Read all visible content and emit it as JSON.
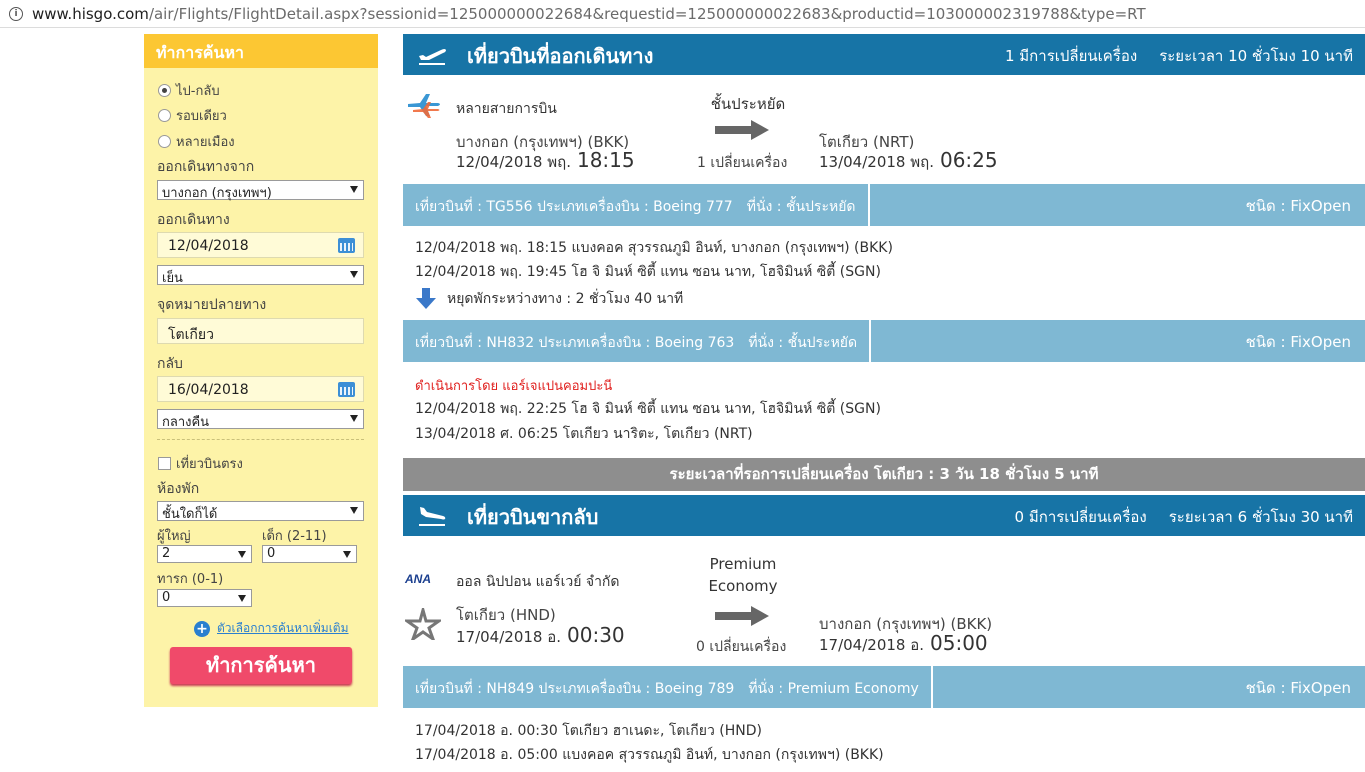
{
  "browser": {
    "url_host": "www.hisgo.com",
    "url_path": "/air/Flights/FlightDetail.aspx?sessionid=125000000022684&requestid=125000000022683&productid=103000002319788&type=RT"
  },
  "sidebar": {
    "title": "ทำการค้นหา",
    "trip_types": [
      {
        "label": "ไป-กลับ",
        "selected": true
      },
      {
        "label": "รอบเดียว",
        "selected": false
      },
      {
        "label": "หลายเมือง",
        "selected": false
      }
    ],
    "origin_label": "ออกเดินทางจาก",
    "origin_value": "บางกอก (กรุงเทพฯ)",
    "depart_label": "ออกเดินทาง",
    "depart_date": "12/04/2018",
    "depart_time": "เย็น",
    "destination_label": "จุดหมายปลายทาง",
    "destination_value": "โตเกียว",
    "return_label": "กลับ",
    "return_date": "16/04/2018",
    "return_time": "กลางคืน",
    "direct_label": "เที่ยวบินตรง",
    "cabin_label": "ห้องพัก",
    "cabin_value": "ชั้นใดก็ได้",
    "adult_label": "ผู้ใหญ่",
    "adult_value": "2",
    "child_label": "เด็ก (2-11)",
    "child_value": "0",
    "infant_label": "ทารก (0-1)",
    "infant_value": "0",
    "more_options": "ตัวเลือกการค้นหาเพิ่มเติม",
    "search_button": "ทำการค้นหา"
  },
  "outbound": {
    "title": "เที่ยวบินที่ออกเดินทาง",
    "stops_summary": "1 มีการเปลี่ยนเครื่อง",
    "duration_summary": "ระยะเวลา 10 ชั่วโมง 10 นาที",
    "airline": "หลายสายการบิน",
    "cabin": "ชั้นประหยัด",
    "stops": "1 เปลี่ยนเครื่อง",
    "from_city": "บางกอก (กรุงเทพฯ) (BKK)",
    "from_date": "12/04/2018 พฤ.",
    "from_time": "18:15",
    "to_city": "โตเกียว (NRT)",
    "to_date": "13/04/2018 พฤ.",
    "to_time": "06:25",
    "segments": [
      {
        "flight": "เที่ยวบินที่ : TG556 ประเภทเครื่องบิน : Boeing 777",
        "seat": "ที่นั่ง : ชั้นประหยัด",
        "fare_type": "ชนิด : FixOpen",
        "depart": "12/04/2018 พฤ. 18:15 แบงคอค สุวรรณภูมิ อินท์, บางกอก (กรุงเทพฯ) (BKK)",
        "arrive": "12/04/2018 พฤ. 19:45 โฮ จิ มินห์ ซิตี้ แทน ซอน นาท, โฮจิมินห์ ซิตี้ (SGN)"
      },
      {
        "flight": "เที่ยวบินที่ : NH832 ประเภทเครื่องบิน : Boeing 763",
        "seat": "ที่นั่ง : ชั้นประหยัด",
        "fare_type": "ชนิด : FixOpen",
        "operated_by": "ดำเนินการโดย แอร์เจแปนคอมปะนี",
        "depart": "12/04/2018 พฤ. 22:25 โฮ จิ มินห์ ซิตี้ แทน ซอน นาท, โฮจิมินห์ ซิตี้ (SGN)",
        "arrive": "13/04/2018 ศ. 06:25 โตเกียว นาริตะ, โตเกียว (NRT)"
      }
    ],
    "layover": "หยุดพักระหว่างทาง : 2 ชั่วโมง 40 นาที"
  },
  "stay_bar": "ระยะเวลาที่รอการเปลี่ยนเครื่อง โตเกียว : 3 วัน 18 ชั่วโมง 5 นาที",
  "inbound": {
    "title": "เที่ยวบินขากลับ",
    "stops_summary": "0 มีการเปลี่ยนเครื่อง",
    "duration_summary": "ระยะเวลา 6 ชั่วโมง 30 นาที",
    "airline_logo_text": "ANA",
    "airline": "ออล นิปปอน แอร์เวย์ จำกัด",
    "cabin": "Premium Economy",
    "stops": "0 เปลี่ยนเครื่อง",
    "from_city": "โตเกียว (HND)",
    "from_date": "17/04/2018 อ.",
    "from_time": "00:30",
    "to_city": "บางกอก (กรุงเทพฯ) (BKK)",
    "to_date": "17/04/2018 อ.",
    "to_time": "05:00",
    "segment": {
      "flight": "เที่ยวบินที่ : NH849 ประเภทเครื่องบิน : Boeing 789",
      "seat": "ที่นั่ง : Premium Economy",
      "fare_type": "ชนิด : FixOpen",
      "depart": "17/04/2018 อ. 00:30 โตเกียว ฮาเนดะ, โตเกียว (HND)",
      "arrive": "17/04/2018 อ. 05:00 แบงคอค สุวรรณภูมิ อินท์, บางกอก (กรุงเทพฯ) (BKK)"
    }
  },
  "colors": {
    "header_blue": "#1774a6",
    "flight_bar": "#7fb8d3",
    "sidebar_bg": "#fdf3a8",
    "sidebar_head": "#fcc733",
    "search_button": "#f04a6a"
  }
}
